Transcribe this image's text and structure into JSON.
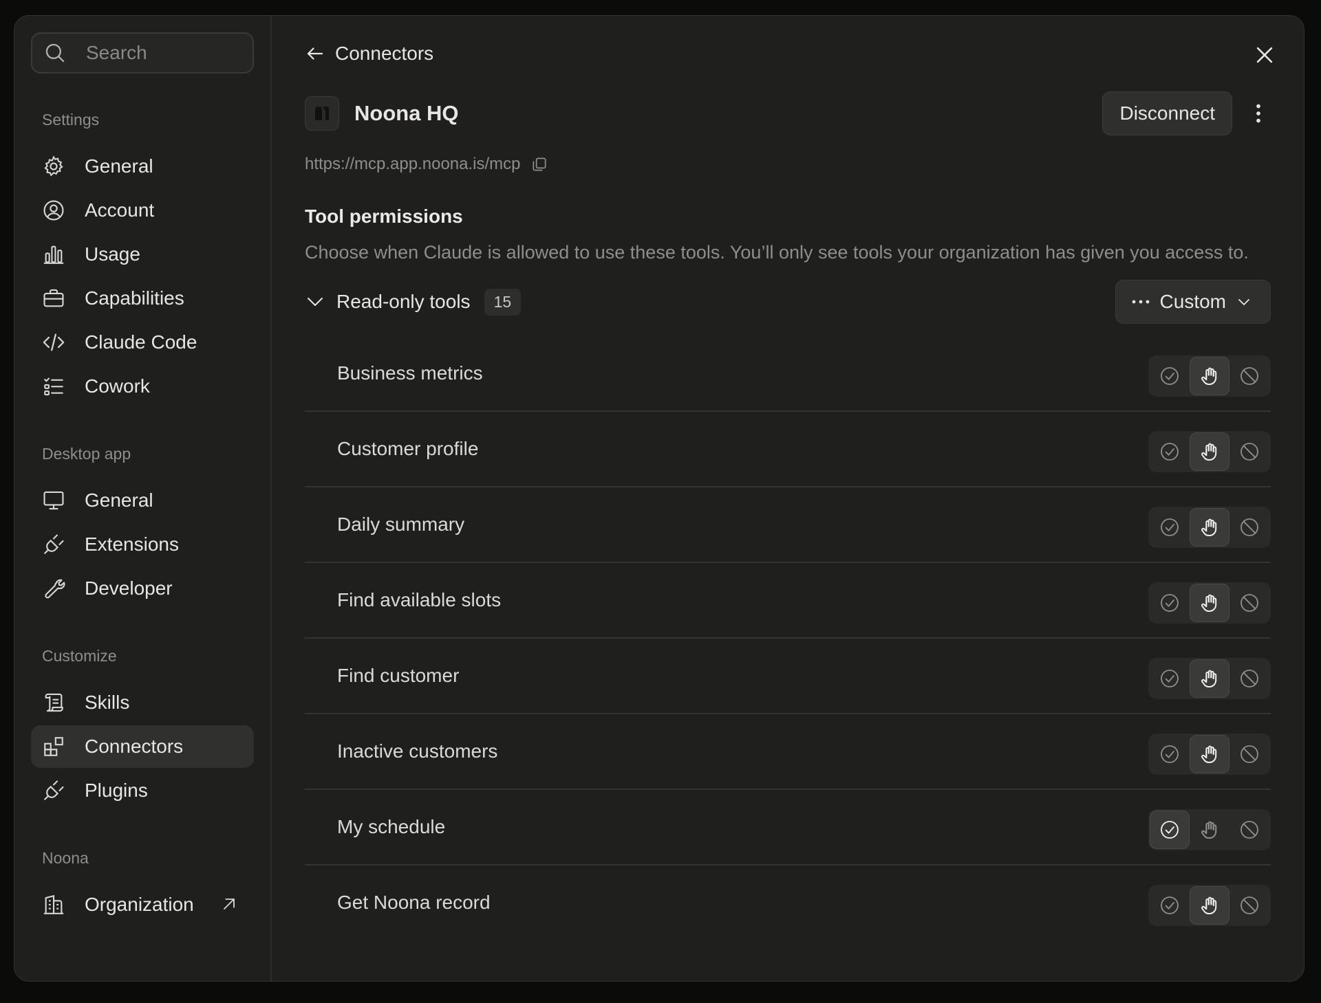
{
  "sidebar": {
    "search_placeholder": "Search",
    "sections": [
      {
        "label": "Settings",
        "items": [
          {
            "label": "General",
            "icon": "gear-icon"
          },
          {
            "label": "Account",
            "icon": "user-circle-icon"
          },
          {
            "label": "Usage",
            "icon": "bar-chart-icon"
          },
          {
            "label": "Capabilities",
            "icon": "briefcase-icon"
          },
          {
            "label": "Claude Code",
            "icon": "code-icon"
          },
          {
            "label": "Cowork",
            "icon": "checklist-icon"
          }
        ]
      },
      {
        "label": "Desktop app",
        "items": [
          {
            "label": "General",
            "icon": "monitor-icon"
          },
          {
            "label": "Extensions",
            "icon": "plug-icon"
          },
          {
            "label": "Developer",
            "icon": "wrench-icon"
          }
        ]
      },
      {
        "label": "Customize",
        "items": [
          {
            "label": "Skills",
            "icon": "scroll-icon"
          },
          {
            "label": "Connectors",
            "icon": "blocks-icon",
            "active": true
          },
          {
            "label": "Plugins",
            "icon": "plug-icon"
          }
        ]
      },
      {
        "label": "Noona",
        "items": [
          {
            "label": "Organization",
            "icon": "building-icon",
            "external": true
          }
        ]
      }
    ]
  },
  "main": {
    "back_label": "Connectors",
    "connector": {
      "name": "Noona HQ",
      "url": "https://mcp.app.noona.is/mcp",
      "disconnect_label": "Disconnect"
    },
    "permissions": {
      "title": "Tool permissions",
      "description": "Choose when Claude is allowed to use these tools. You’ll only see tools your organization has given you access to.",
      "group": {
        "label": "Read-only tools",
        "count": "15",
        "mode_label": "Custom"
      },
      "tools": [
        {
          "name": "Business metrics",
          "permission": "ask"
        },
        {
          "name": "Customer profile",
          "permission": "ask"
        },
        {
          "name": "Daily summary",
          "permission": "ask"
        },
        {
          "name": "Find available slots",
          "permission": "ask"
        },
        {
          "name": "Find customer",
          "permission": "ask"
        },
        {
          "name": "Inactive customers",
          "permission": "ask"
        },
        {
          "name": "My schedule",
          "permission": "allow"
        },
        {
          "name": "Get Noona record",
          "permission": "ask"
        }
      ]
    }
  }
}
